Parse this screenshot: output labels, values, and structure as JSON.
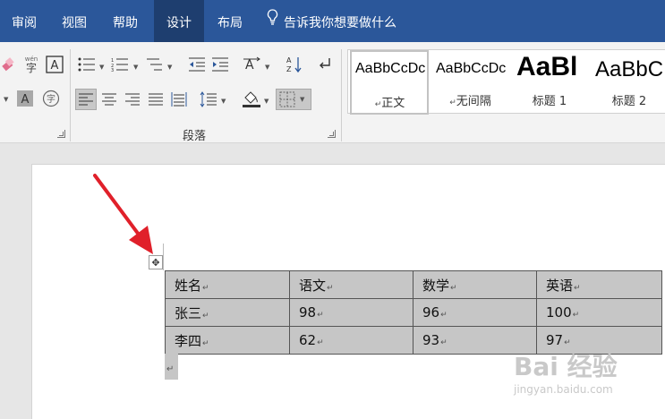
{
  "tabs": [
    {
      "label": "审阅",
      "active": false
    },
    {
      "label": "视图",
      "active": false
    },
    {
      "label": "帮助",
      "active": false
    },
    {
      "label": "设计",
      "active": true
    },
    {
      "label": "布局",
      "active": false
    }
  ],
  "tell_me": "告诉我你想要做什么",
  "ribbon": {
    "paragraph_group_label": "段落",
    "font_small_icons": {
      "pinyin": "wén",
      "char": "字",
      "circle_char": "字"
    },
    "styles": [
      {
        "sample": "AaBbCcDc",
        "name": "正文",
        "para_mark": "↵"
      },
      {
        "sample": "AaBbCcDc",
        "name": "无间隔",
        "para_mark": "↵"
      },
      {
        "sample": "AaBl",
        "name": "标题 1"
      },
      {
        "sample": "AaBbC",
        "name": "标题 2"
      }
    ]
  },
  "table": {
    "para_mark": "↵",
    "rows": [
      [
        "姓名",
        "语文",
        "数学",
        "英语"
      ],
      [
        "张三",
        "98",
        "96",
        "100"
      ],
      [
        "李四",
        "62",
        "93",
        "97"
      ]
    ]
  },
  "watermark": {
    "main": "Bai 经验",
    "sub": "jingyan.baidu.com"
  },
  "colors": {
    "titlebar": "#2b579a",
    "active_tab": "#1e3e6f",
    "selection": "#c6c6c6",
    "arrow": "#e0202a"
  }
}
